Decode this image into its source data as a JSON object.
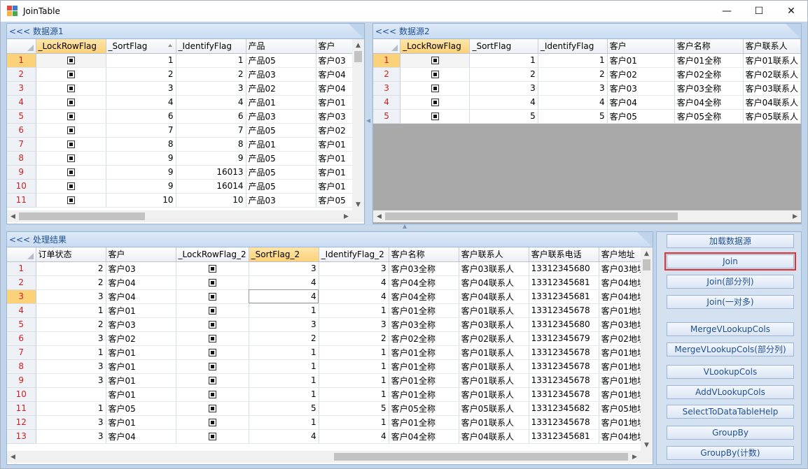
{
  "window": {
    "title": "JoinTable",
    "minimize": "—",
    "maximize": "☐",
    "close": "✕"
  },
  "colors": {
    "accent": "#1d4f91",
    "header_bg": "#c9dcf2",
    "sorted_header": "#fbd27a",
    "row_header_text": "#cc2020",
    "highlight_border": "#e23030"
  },
  "source1": {
    "title": "<<< 数据源1",
    "columns": [
      "_LockRowFlag",
      "_SortFlag",
      "_IdentifyFlag",
      "产品",
      "客户"
    ],
    "rows": [
      {
        "n": "1",
        "sort": "1",
        "id": "1",
        "p": "产品05",
        "c": "客户03"
      },
      {
        "n": "2",
        "sort": "2",
        "id": "2",
        "p": "产品03",
        "c": "客户04"
      },
      {
        "n": "3",
        "sort": "3",
        "id": "3",
        "p": "产品02",
        "c": "客户04"
      },
      {
        "n": "4",
        "sort": "4",
        "id": "4",
        "p": "产品01",
        "c": "客户01"
      },
      {
        "n": "5",
        "sort": "6",
        "id": "6",
        "p": "产品03",
        "c": "客户03"
      },
      {
        "n": "6",
        "sort": "7",
        "id": "7",
        "p": "产品05",
        "c": "客户02"
      },
      {
        "n": "7",
        "sort": "8",
        "id": "8",
        "p": "产品01",
        "c": "客户01"
      },
      {
        "n": "8",
        "sort": "9",
        "id": "9",
        "p": "产品05",
        "c": "客户01"
      },
      {
        "n": "9",
        "sort": "9",
        "id": "16013",
        "p": "产品05",
        "c": "客户01"
      },
      {
        "n": "10",
        "sort": "9",
        "id": "16014",
        "p": "产品05",
        "c": "客户01"
      },
      {
        "n": "11",
        "sort": "10",
        "id": "10",
        "p": "产品03",
        "c": "客户05"
      }
    ]
  },
  "source2": {
    "title": "<<< 数据源2",
    "columns": [
      "_LockRowFlag",
      "_SortFlag",
      "_IdentifyFlag",
      "客户",
      "客户名称",
      "客户联系人"
    ],
    "rows": [
      {
        "n": "1",
        "sort": "1",
        "id": "1",
        "c": "客户01",
        "name": "客户01全称",
        "contact": "客户01联系人"
      },
      {
        "n": "2",
        "sort": "2",
        "id": "2",
        "c": "客户02",
        "name": "客户02全称",
        "contact": "客户02联系人"
      },
      {
        "n": "3",
        "sort": "3",
        "id": "3",
        "c": "客户03",
        "name": "客户03全称",
        "contact": "客户03联系人"
      },
      {
        "n": "4",
        "sort": "4",
        "id": "4",
        "c": "客户04",
        "name": "客户04全称",
        "contact": "客户04联系人"
      },
      {
        "n": "5",
        "sort": "5",
        "id": "5",
        "c": "客户05",
        "name": "客户05全称",
        "contact": "客户05联系人"
      }
    ]
  },
  "result": {
    "title": "<<< 处理结果",
    "columns": [
      "订单状态",
      "客户",
      "_LockRowFlag_2",
      "_SortFlag_2",
      "_IdentifyFlag_2",
      "客户名称",
      "客户联系人",
      "客户联系电话",
      "客户地址"
    ],
    "rows": [
      {
        "n": "1",
        "st": "2",
        "c": "客户03",
        "sort": "3",
        "id": "3",
        "name": "客户03全称",
        "contact": "客户03联系人",
        "phone": "13312345680",
        "addr": "客户03地址"
      },
      {
        "n": "2",
        "st": "2",
        "c": "客户04",
        "sort": "4",
        "id": "4",
        "name": "客户04全称",
        "contact": "客户04联系人",
        "phone": "13312345681",
        "addr": "客户04地址"
      },
      {
        "n": "3",
        "st": "3",
        "c": "客户04",
        "sort": "4",
        "id": "4",
        "name": "客户04全称",
        "contact": "客户04联系人",
        "phone": "13312345681",
        "addr": "客户04地址"
      },
      {
        "n": "4",
        "st": "1",
        "c": "客户01",
        "sort": "1",
        "id": "1",
        "name": "客户01全称",
        "contact": "客户01联系人",
        "phone": "13312345678",
        "addr": "客户01地址"
      },
      {
        "n": "5",
        "st": "2",
        "c": "客户03",
        "sort": "3",
        "id": "3",
        "name": "客户03全称",
        "contact": "客户03联系人",
        "phone": "13312345680",
        "addr": "客户03地址"
      },
      {
        "n": "6",
        "st": "3",
        "c": "客户02",
        "sort": "2",
        "id": "2",
        "name": "客户02全称",
        "contact": "客户02联系人",
        "phone": "13312345679",
        "addr": "客户02地址"
      },
      {
        "n": "7",
        "st": "1",
        "c": "客户01",
        "sort": "1",
        "id": "1",
        "name": "客户01全称",
        "contact": "客户01联系人",
        "phone": "13312345678",
        "addr": "客户01地址"
      },
      {
        "n": "8",
        "st": "3",
        "c": "客户01",
        "sort": "1",
        "id": "1",
        "name": "客户01全称",
        "contact": "客户01联系人",
        "phone": "13312345678",
        "addr": "客户01地址"
      },
      {
        "n": "9",
        "st": "3",
        "c": "客户01",
        "sort": "1",
        "id": "1",
        "name": "客户01全称",
        "contact": "客户01联系人",
        "phone": "13312345678",
        "addr": "客户01地址"
      },
      {
        "n": "10",
        "st": "",
        "c": "客户01",
        "sort": "1",
        "id": "1",
        "name": "客户01全称",
        "contact": "客户01联系人",
        "phone": "13312345678",
        "addr": "客户01地址"
      },
      {
        "n": "11",
        "st": "1",
        "c": "客户05",
        "sort": "5",
        "id": "5",
        "name": "客户05全称",
        "contact": "客户05联系人",
        "phone": "13312345682",
        "addr": "客户05地址"
      },
      {
        "n": "12",
        "st": "3",
        "c": "客户01",
        "sort": "1",
        "id": "1",
        "name": "客户01全称",
        "contact": "客户01联系人",
        "phone": "13312345678",
        "addr": "客户01地址"
      },
      {
        "n": "13",
        "st": "3",
        "c": "客户04",
        "sort": "4",
        "id": "4",
        "name": "客户04全称",
        "contact": "客户04联系人",
        "phone": "13312345681",
        "addr": "客户04地址"
      }
    ]
  },
  "buttons": {
    "load": "加载数据源",
    "join": "Join",
    "join_partial": "Join(部分列)",
    "join_one_many": "Join(一对多)",
    "merge_vlookup": "MergeVLookupCols",
    "merge_vlookup_partial": "MergeVLookupCols(部分列)",
    "vlookup": "VLookupCols",
    "add_vlookup": "AddVLookupCols",
    "select_help": "SelectToDataTableHelp",
    "groupby": "GroupBy",
    "groupby_count": "GroupBy(计数)"
  }
}
